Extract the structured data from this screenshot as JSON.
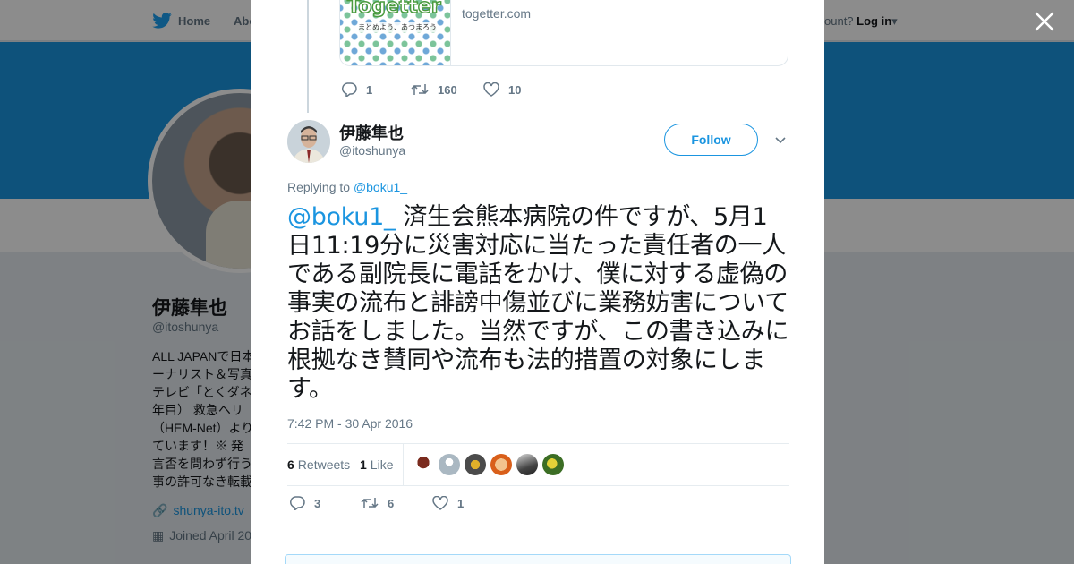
{
  "background": {
    "nav": {
      "home": "Home",
      "about": "Abo",
      "account_prompt": "ccount?",
      "login": "Log in"
    },
    "profile": {
      "name": "伊藤隼也",
      "handle": "@itoshunya",
      "bio": "ALL JAPANで日本ーナリスト＆写真テレビ「とくダネ年目） 救急ヘリ（HEM-Net）よりています！※ 発言否を問わず行う事の許可なき転載引",
      "link": "shunya-ito.tv",
      "joined": "Joined April 20"
    },
    "colors": {
      "banner": "#1b95e0",
      "overlay": "rgba(0,0,0,0.45)"
    }
  },
  "modal": {
    "close_icon": "close-icon",
    "previous_tweet": {
      "card": {
        "logo": "Togetter",
        "tagline": "まとめよう、あつまろう",
        "domain": "togetter.com"
      },
      "reply_count": "1",
      "retweet_count": "160",
      "like_count": "10"
    },
    "tweet": {
      "author_name": "伊藤隼也",
      "author_handle": "@itoshunya",
      "follow_label": "Follow",
      "replying_label": "Replying to",
      "replying_to": "@boku1_",
      "mention": "@boku1_",
      "text": " 済生会熊本病院の件ですが、5月1日11:19分に災害対応に当たった責任者の一人である副院長に電話をかけ、僕に対する虚偽の事実の流布と誹謗中傷並びに業務妨害についてお話をしました。当然ですが、この書き込みに根拠なき賛同や流布も法的措置の対象にします。",
      "timestamp": "7:42 PM - 30 Apr 2016",
      "retweets_count": "6",
      "retweets_label": "Retweets",
      "likes_count": "1",
      "likes_label": "Like",
      "reply_count": "3",
      "retweet_count": "6",
      "like_count": "1"
    },
    "accent_color": "#1b95e0"
  }
}
